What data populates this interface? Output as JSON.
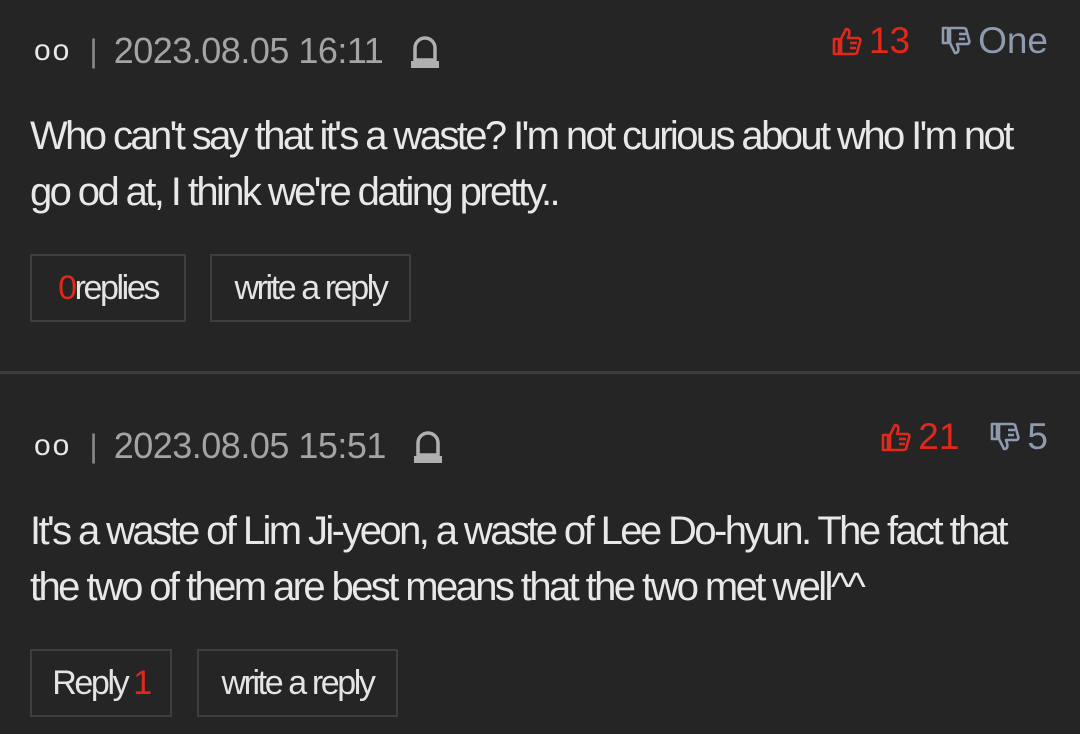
{
  "comments": [
    {
      "author": "oo",
      "separator": "|",
      "date": "2023.08.05 16:11",
      "likes": "13",
      "dislikes": "One",
      "text": "Who can't say that it's a waste? I'm not curious about who I'm not go od at, I think we're dating pretty..",
      "replies_count": "0",
      "replies_label": "replies",
      "write_reply_label": "write a reply"
    },
    {
      "author": "oo",
      "separator": "|",
      "date": "2023.08.05 15:51",
      "likes": "21",
      "dislikes": "5",
      "text": "It's a waste of Lim Ji-yeon, a waste of Lee Do-hyun. The fact that the two of them are best means that the two met well^^",
      "replies_label": "Reply",
      "replies_count": "1",
      "write_reply_label": "write a reply"
    }
  ],
  "icons": {
    "report": "siren-icon",
    "like": "thumbs-up-icon",
    "dislike": "thumbs-down-icon"
  },
  "colors": {
    "background": "#252525",
    "accent_red": "#e0281b",
    "dislike_blue_gray": "#8d9ab0",
    "date_gray": "#a4a4a4"
  }
}
